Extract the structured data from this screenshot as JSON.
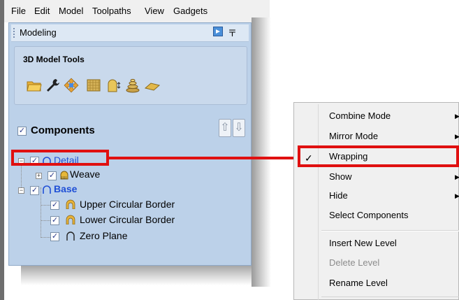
{
  "menubar": {
    "items": [
      "File",
      "Edit",
      "Model",
      "Toolpaths",
      "View",
      "Gadgets"
    ]
  },
  "panel": {
    "title": "Modeling",
    "pin_glyph": "〒",
    "section_title": "3D Model Tools",
    "tools": [
      "open-folder-icon",
      "wrench-icon",
      "move-arrows-icon",
      "texture-grid-icon",
      "model-sculpt-icon",
      "stack-layers-icon",
      "flat-plane-icon"
    ]
  },
  "components": {
    "label": "Components",
    "checkbox_checked": true,
    "up_glyph": "⇧",
    "down_glyph": "⇩",
    "tree": [
      {
        "label": "Detail",
        "checked": true,
        "color": "#1f4fd6",
        "bold": false,
        "selected": true,
        "icon": "arch-outline-icon"
      },
      {
        "label": "Weave",
        "checked": true,
        "color": "#000000",
        "bold": false,
        "icon": "arch-texture-icon"
      },
      {
        "label": "Base",
        "checked": true,
        "color": "#1f4fd6",
        "bold": true,
        "icon": "arch-outline-icon"
      },
      {
        "label": "Upper Circular Border",
        "checked": true,
        "color": "#000000",
        "bold": false,
        "icon": "arch-solid-icon"
      },
      {
        "label": "Lower Circular Border",
        "checked": true,
        "color": "#000000",
        "bold": false,
        "icon": "arch-solid-icon"
      },
      {
        "label": "Zero Plane",
        "checked": true,
        "color": "#000000",
        "bold": false,
        "icon": "arch-line-icon"
      }
    ],
    "check_glyph": "✓",
    "expander_open": "−",
    "expander_closed": "+"
  },
  "context_menu": {
    "items": [
      {
        "label": "Combine Mode",
        "submenu": true,
        "enabled": true
      },
      {
        "label": "Mirror Mode",
        "submenu": true,
        "enabled": true
      },
      {
        "label": "Wrapping",
        "submenu": false,
        "enabled": true,
        "checked": true
      },
      {
        "label": "Show",
        "submenu": true,
        "enabled": true
      },
      {
        "label": "Hide",
        "submenu": true,
        "enabled": true
      },
      {
        "label": "Select Components",
        "submenu": false,
        "enabled": true
      },
      {
        "label": "Insert New Level",
        "submenu": false,
        "enabled": true
      },
      {
        "label": "Delete Level",
        "submenu": false,
        "enabled": false
      },
      {
        "label": "Rename Level",
        "submenu": false,
        "enabled": true
      }
    ],
    "check_glyph": "✓",
    "submenu_glyph": "▶"
  },
  "colors": {
    "highlight": "#e01010",
    "panel_bg": "#bcd1e9",
    "tree_link": "#1f4fd6",
    "disabled_text": "#8c8c8c"
  }
}
